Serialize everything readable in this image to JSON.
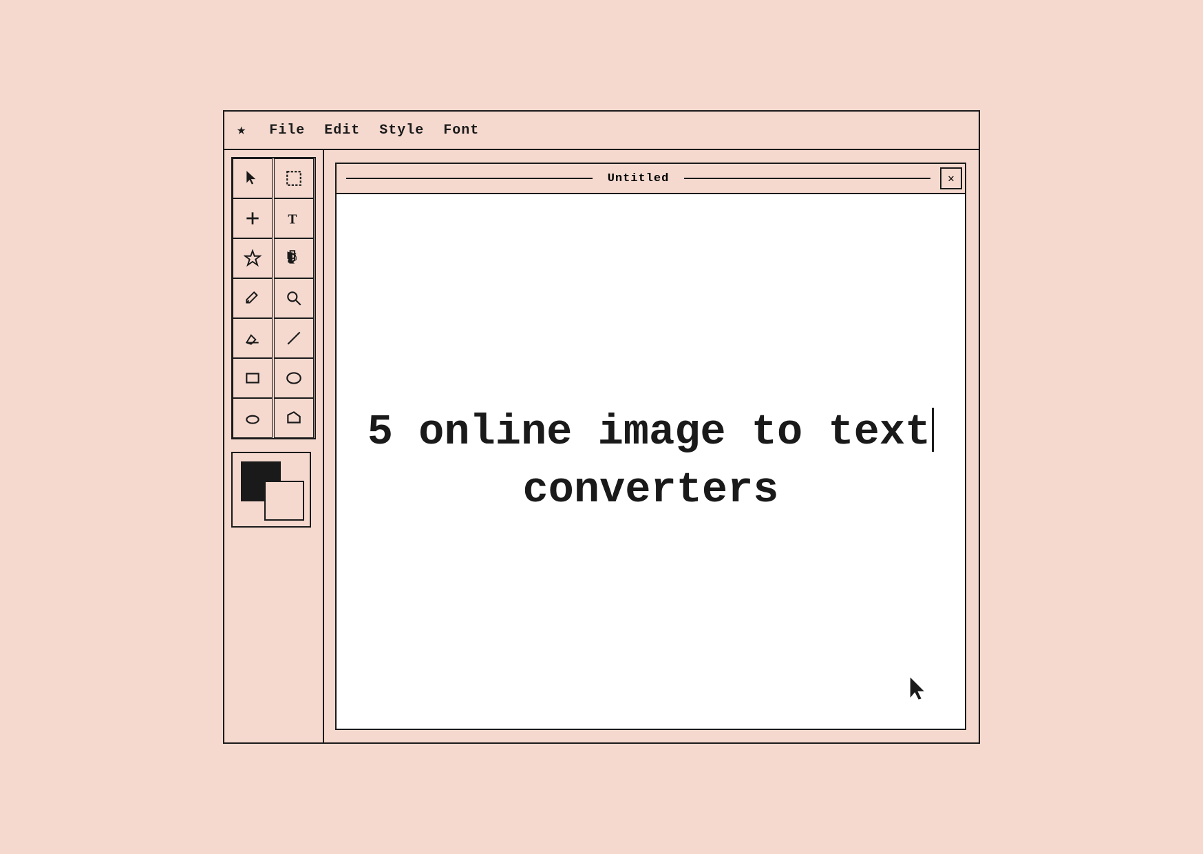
{
  "app": {
    "background_color": "#f5d9cf",
    "window_border_color": "#1a1a1a"
  },
  "menu_bar": {
    "star": "★",
    "items": [
      {
        "label": "File"
      },
      {
        "label": "Edit"
      },
      {
        "label": "Style"
      },
      {
        "label": "Font"
      }
    ]
  },
  "toolbar": {
    "tools": [
      {
        "name": "select-arrow",
        "icon": "arrow"
      },
      {
        "name": "marquee-select",
        "icon": "dashed-rect"
      },
      {
        "name": "add-shape",
        "icon": "plus"
      },
      {
        "name": "text-tool",
        "icon": "T"
      },
      {
        "name": "star-shape",
        "icon": "star"
      },
      {
        "name": "paint-bucket",
        "icon": "bucket"
      },
      {
        "name": "pencil-tool",
        "icon": "pencil"
      },
      {
        "name": "magnify-tool",
        "icon": "magnify"
      },
      {
        "name": "eraser-tool",
        "icon": "eraser"
      },
      {
        "name": "line-tool",
        "icon": "line"
      },
      {
        "name": "rectangle-tool",
        "icon": "rect"
      },
      {
        "name": "oval-tool",
        "icon": "oval"
      },
      {
        "name": "ellipse-tool",
        "icon": "ellipse"
      },
      {
        "name": "polygon-tool",
        "icon": "polygon"
      }
    ],
    "colors": {
      "foreground": "#1a1a1a",
      "background": "#f5d9cf"
    }
  },
  "canvas": {
    "title": "Untitled",
    "close_label": "✕",
    "content_line1": "5 online image to text",
    "content_line2": "converters"
  }
}
